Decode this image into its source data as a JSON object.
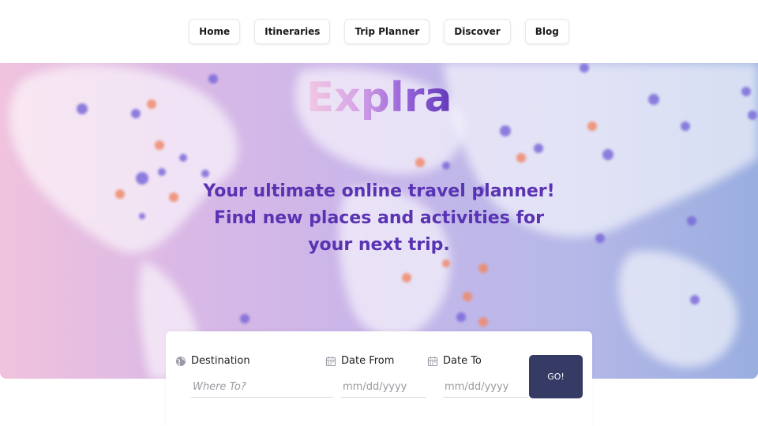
{
  "nav": {
    "items": [
      {
        "label": "Home"
      },
      {
        "label": "Itineraries"
      },
      {
        "label": "Trip Planner"
      },
      {
        "label": "Discover"
      },
      {
        "label": "Blog"
      }
    ]
  },
  "hero": {
    "brand": "Explra",
    "tagline_line1": "Your ultimate online travel planner!",
    "tagline_line2": "Find new places and activities for your next trip."
  },
  "search": {
    "destination": {
      "label": "Destination",
      "placeholder": "Where To?",
      "icon": "globe-icon"
    },
    "date_from": {
      "label": "Date From",
      "placeholder": "mm/dd/yyyy",
      "icon": "calendar-icon"
    },
    "date_to": {
      "label": "Date To",
      "placeholder": "mm/dd/yyyy",
      "icon": "calendar-icon"
    },
    "go_label": "GO!"
  },
  "colors": {
    "accent": "#5a33b3",
    "button": "#363b66",
    "hero_left": "#f0c2dd",
    "hero_right": "#9aaee0"
  }
}
